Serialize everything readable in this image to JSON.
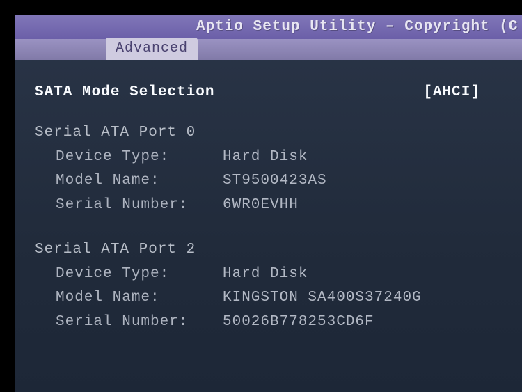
{
  "header": {
    "title": "Aptio Setup Utility – Copyright (C"
  },
  "tabs": {
    "active": "Advanced"
  },
  "sata_mode": {
    "label": "SATA Mode Selection",
    "value": "[AHCI]"
  },
  "ports": [
    {
      "title": "Serial ATA Port 0",
      "device_type_label": "Device Type:",
      "device_type": "Hard Disk",
      "model_label": "Model Name:",
      "model": "ST9500423AS",
      "serial_label": "Serial Number:",
      "serial": "6WR0EVHH"
    },
    {
      "title": "Serial ATA Port 2",
      "device_type_label": "Device Type:",
      "device_type": "Hard Disk",
      "model_label": "Model Name:",
      "model": "KINGSTON SA400S37240G",
      "serial_label": "Serial Number:",
      "serial": "50026B778253CD6F"
    }
  ]
}
